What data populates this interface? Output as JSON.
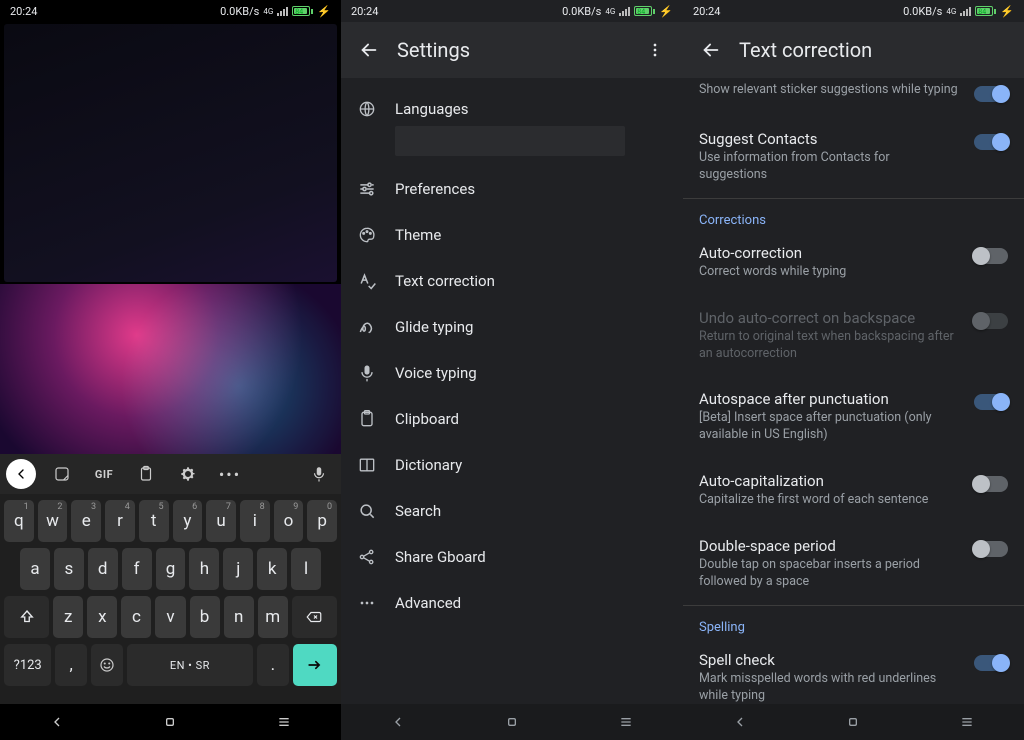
{
  "status": {
    "time": "20:24",
    "net": "0.0KB/s",
    "rat": "4G",
    "battery_pct": "84"
  },
  "screen1": {
    "keyboard": {
      "space_label": "EN • SR",
      "gif_label": "GIF",
      "sym_label": "?123",
      "row1": [
        {
          "k": "q",
          "n": "1"
        },
        {
          "k": "w",
          "n": "2"
        },
        {
          "k": "e",
          "n": "3"
        },
        {
          "k": "r",
          "n": "4"
        },
        {
          "k": "t",
          "n": "5"
        },
        {
          "k": "y",
          "n": "6"
        },
        {
          "k": "u",
          "n": "7"
        },
        {
          "k": "i",
          "n": "8"
        },
        {
          "k": "o",
          "n": "9"
        },
        {
          "k": "p",
          "n": "0"
        }
      ],
      "row2": [
        "a",
        "s",
        "d",
        "f",
        "g",
        "h",
        "j",
        "k",
        "l"
      ],
      "row3": [
        "z",
        "x",
        "c",
        "v",
        "b",
        "n",
        "m"
      ],
      "comma": ",",
      "period": "."
    }
  },
  "screen2": {
    "title": "Settings",
    "items": [
      {
        "icon": "globe",
        "label": "Languages"
      },
      {
        "icon": "tune",
        "label": "Preferences"
      },
      {
        "icon": "palette",
        "label": "Theme"
      },
      {
        "icon": "spellcheck",
        "label": "Text correction"
      },
      {
        "icon": "gesture",
        "label": "Glide typing"
      },
      {
        "icon": "mic",
        "label": "Voice typing"
      },
      {
        "icon": "clipboard",
        "label": "Clipboard"
      },
      {
        "icon": "book",
        "label": "Dictionary"
      },
      {
        "icon": "search",
        "label": "Search"
      },
      {
        "icon": "share",
        "label": "Share Gboard"
      },
      {
        "icon": "more",
        "label": "Advanced"
      }
    ]
  },
  "screen3": {
    "title": "Text correction",
    "partial": {
      "title": "",
      "sub": "Show relevant sticker suggestions while typing",
      "on": true
    },
    "rows": [
      {
        "title": "Suggest Contacts",
        "sub": "Use information from Contacts for suggestions",
        "on": true
      },
      {
        "section": "Corrections"
      },
      {
        "title": "Auto-correction",
        "sub": "Correct words while typing",
        "on": false
      },
      {
        "title": "Undo auto-correct on backspace",
        "sub": "Return to original text when backspacing after an autocorrection",
        "on": false,
        "disabled": true
      },
      {
        "title": "Autospace after punctuation",
        "sub": "[Beta] Insert space after punctuation (only available in US English)",
        "on": true
      },
      {
        "title": "Auto-capitalization",
        "sub": "Capitalize the first word of each sentence",
        "on": false
      },
      {
        "title": "Double-space period",
        "sub": "Double tap on spacebar inserts a period followed by a space",
        "on": false
      },
      {
        "section": "Spelling"
      },
      {
        "title": "Spell check",
        "sub": "Mark misspelled words with red underlines while typing",
        "on": true
      }
    ]
  }
}
